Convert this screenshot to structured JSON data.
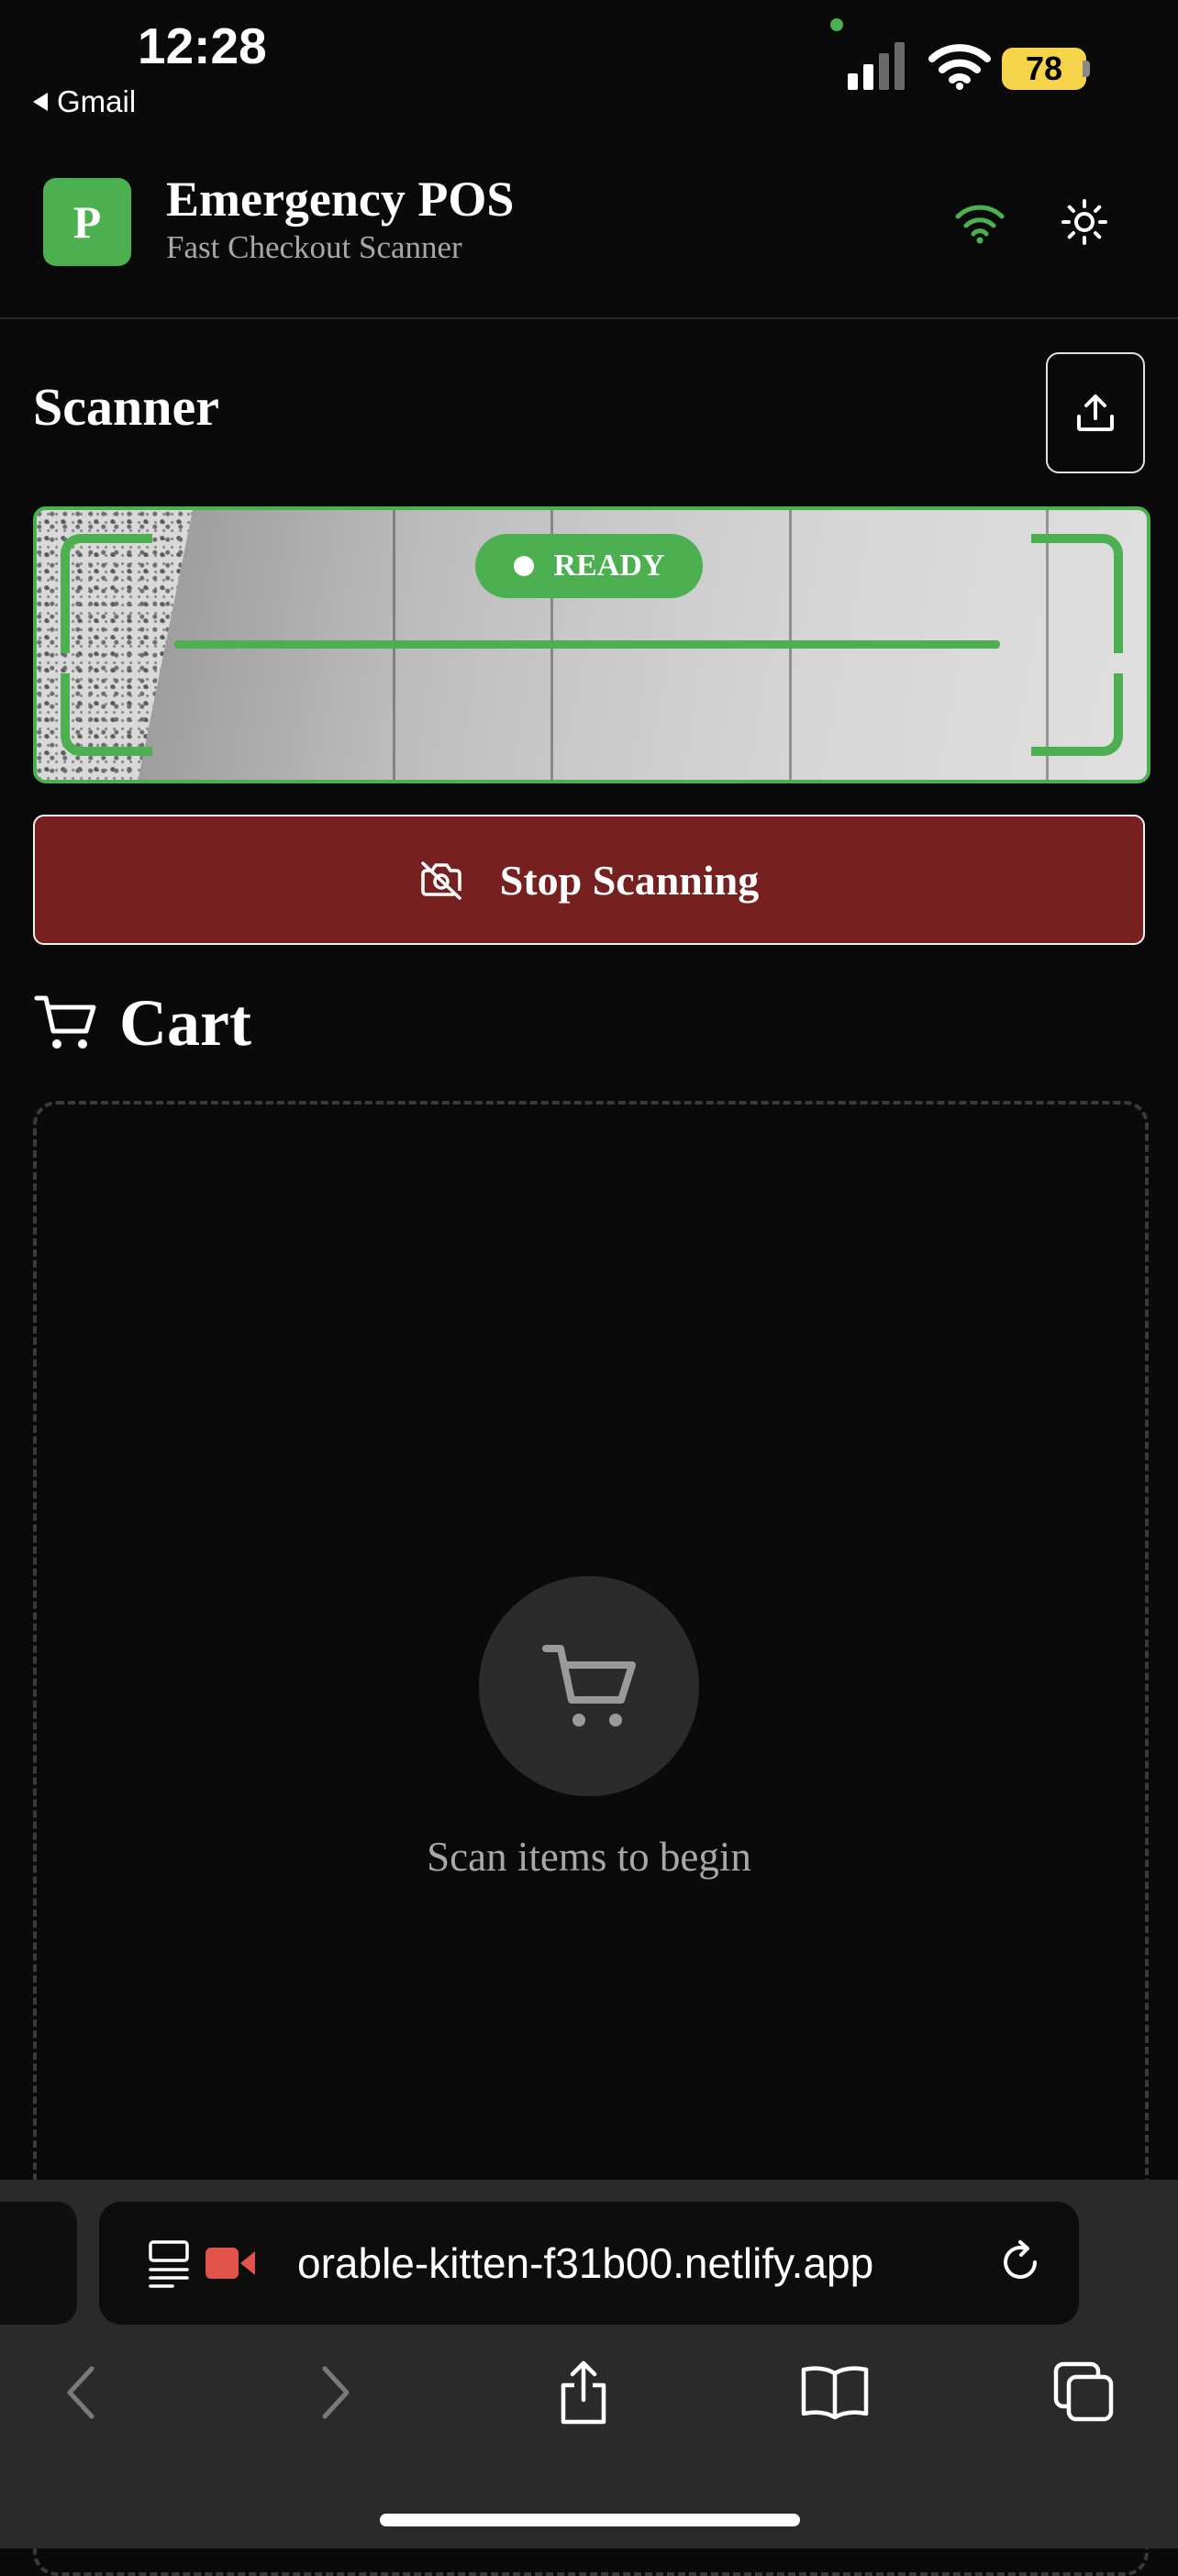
{
  "status_bar": {
    "time": "12:28",
    "back_app": "Gmail",
    "battery": "78",
    "icons": [
      "signal-icon",
      "wifi-icon",
      "battery-icon"
    ]
  },
  "header": {
    "logo_letter": "P",
    "title": "Emergency POS",
    "subtitle": "Fast Checkout Scanner",
    "icons": [
      "connection-wifi-icon",
      "theme-toggle-sun-icon"
    ],
    "accent_color": "#4caf50"
  },
  "scanner": {
    "title": "Scanner",
    "status": "READY",
    "stop_label": "Stop Scanning",
    "stop_color": "#762020"
  },
  "cart": {
    "title": "Cart",
    "empty_message": "Scan items to begin"
  },
  "browser": {
    "url": "orable-kitten-f31b00.netlify.app",
    "icons": [
      "reader-icon",
      "screen-record-icon",
      "reload-icon",
      "back-icon",
      "forward-icon",
      "share-icon",
      "bookmarks-icon",
      "tabs-icon"
    ]
  }
}
